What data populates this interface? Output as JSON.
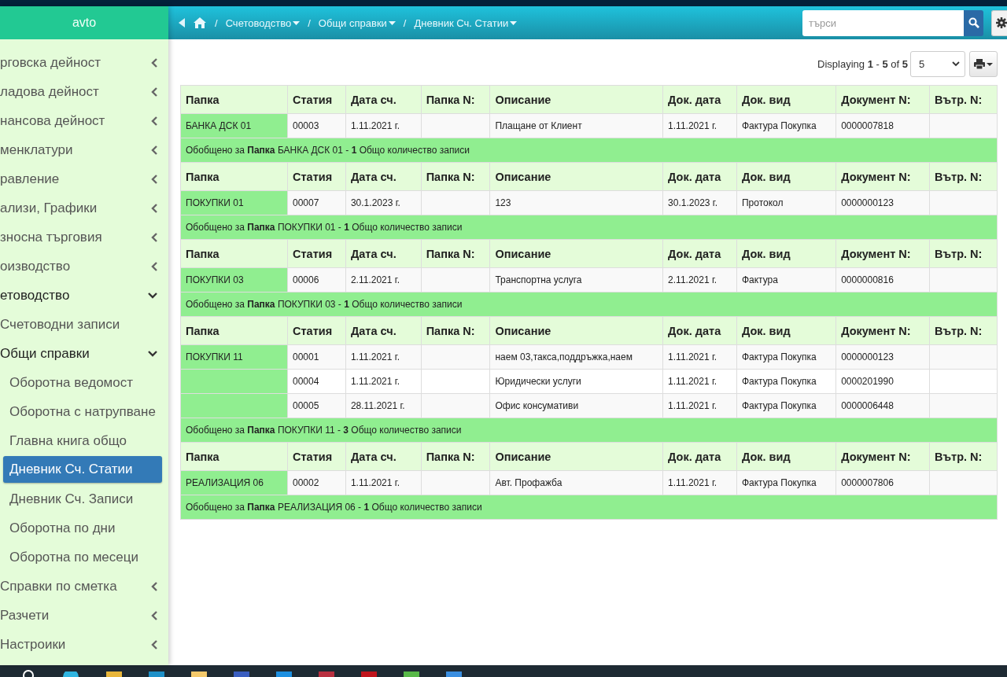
{
  "sidebar": {
    "title": "avto",
    "items": [
      {
        "label": "рговска дейност",
        "expanded": false,
        "selected": false
      },
      {
        "label": "ладова дейност",
        "expanded": false,
        "selected": false
      },
      {
        "label": "нансова дейност",
        "expanded": false,
        "selected": false
      },
      {
        "label": "менклатури",
        "expanded": false,
        "selected": false
      },
      {
        "label": "равление",
        "expanded": false,
        "selected": false
      },
      {
        "label": "ализи, Графики",
        "expanded": false,
        "selected": false
      },
      {
        "label": "зносна търговия",
        "expanded": false,
        "selected": false
      },
      {
        "label": "оизводство",
        "expanded": false,
        "selected": false
      },
      {
        "label": "етоводство",
        "expanded": true,
        "selected": false,
        "children": [
          {
            "label": "Счетоводни записи",
            "selected": false
          },
          {
            "label": "Общи справки",
            "expanded": true,
            "selected": false,
            "children": [
              {
                "label": "Оборотна ведомост",
                "selected": false
              },
              {
                "label": "Оборотна с натрупване",
                "selected": false
              },
              {
                "label": "Главна книга общо",
                "selected": false
              },
              {
                "label": "Дневник Сч. Статии",
                "selected": true
              },
              {
                "label": "Дневник Сч. Записи",
                "selected": false
              },
              {
                "label": "Оборотна по дни",
                "selected": false
              },
              {
                "label": "Оборотна по месеци",
                "selected": false
              }
            ]
          }
        ]
      },
      {
        "label": "Справки по сметка",
        "expanded": false,
        "selected": false
      },
      {
        "label": "Разчети",
        "expanded": false,
        "selected": false
      },
      {
        "label": "Настроики",
        "expanded": false,
        "selected": false
      }
    ]
  },
  "breadcrumb": [
    {
      "label": "Счетоводство",
      "separator": "/"
    },
    {
      "label": "Общи справки",
      "separator": "/"
    },
    {
      "label": "Дневник Сч. Статии",
      "separator": "/"
    }
  ],
  "search": {
    "placeholder": "търси"
  },
  "toolbar": {
    "displaying": "Displaying **1** - **5** of **5**",
    "page_size": "5"
  },
  "table": {
    "groups": [
      {
        "columns": [
          "Папка",
          "Статия",
          "Дата сч.",
          "Папка N:",
          "Описание",
          "Док. дата",
          "Док. вид",
          "Документ N:",
          "Вътр. N:"
        ],
        "rows": [
          {
            "folder": "БАНКА ДСК 01",
            "article": "00003",
            "date": "1.11.2021 г.",
            "description": "Плащане от Клиент",
            "doc_date": "1.11.2021 г.",
            "doc_type": "Фактура Покупка",
            "doc_number": "0000007818"
          }
        ],
        "summary": "Обобщено за **Папка** БАНКА ДСК 01  - **1** Общо количество записи"
      },
      {
        "columns": [
          "Папка",
          "Статия",
          "Дата сч.",
          "Папка N:",
          "Описание",
          "Док. дата",
          "Док. вид",
          "Документ N:",
          "Вътр. N:"
        ],
        "rows": [
          {
            "folder": "ПОКУПКИ 01",
            "article": "00007",
            "date": "30.1.2023 г.",
            "description": "123",
            "doc_date": "30.1.2023 г.",
            "doc_type": "Протокол",
            "doc_number": "0000000123"
          }
        ],
        "summary": "Обобщено за **Папка** ПОКУПКИ 01  - **1** Общо количество записи"
      },
      {
        "columns": [
          "Папка",
          "Статия",
          "Дата сч.",
          "Папка N:",
          "Описание",
          "Док. дата",
          "Док. вид",
          "Документ N:",
          "Вътр. N:"
        ],
        "rows": [
          {
            "folder": "ПОКУПКИ 03",
            "article": "00006",
            "date": "2.11.2021 г.",
            "description": "Транспортна услуга",
            "doc_date": "2.11.2021 г.",
            "doc_type": "Фактура",
            "doc_number": "0000000816"
          }
        ],
        "summary": "Обобщено за **Папка** ПОКУПКИ 03  - **1** Общо количество записи"
      },
      {
        "columns": [
          "Папка",
          "Статия",
          "Дата сч.",
          "Папка N:",
          "Описание",
          "Док. дата",
          "Док. вид",
          "Документ N:",
          "Вътр. N:"
        ],
        "rows": [
          {
            "folder": "ПОКУПКИ 11",
            "article": "00001",
            "date": "1.11.2021 г.",
            "description": "наем 03,такса,поддръжка,наем",
            "doc_date": "1.11.2021 г.",
            "doc_type": "Фактура Покупка",
            "doc_number": "0000000123"
          },
          {
            "article": "00004",
            "date": "1.11.2021 г.",
            "description": "Юридически услуги",
            "doc_date": "1.11.2021 г.",
            "doc_type": "Фактура Покупка",
            "doc_number": "0000201990"
          },
          {
            "article": "00005",
            "date": "28.11.2021 г.",
            "description": "Офис консумативи",
            "doc_date": "1.11.2021 г.",
            "doc_type": "Фактура Покупка",
            "doc_number": "0000006448"
          }
        ],
        "summary": "Обобщено за **Папка** ПОКУПКИ 11  - **3** Общо количество записи"
      },
      {
        "columns": [
          "Папка",
          "Статия",
          "Дата сч.",
          "Папка N:",
          "Описание",
          "Док. дата",
          "Док. вид",
          "Документ N:",
          "Вътр. N:"
        ],
        "rows": [
          {
            "folder": "РЕАЛИЗАЦИЯ 06",
            "article": "00002",
            "date": "1.11.2021 г.",
            "description": "Авт. Профажба",
            "doc_date": "1.11.2021 г.",
            "doc_type": "Фактура Покупка",
            "doc_number": "0000007806"
          }
        ],
        "summary": "Обобщено за **Папка** РЕАЛИЗАЦИЯ 06  - **1** Общо количество записи"
      }
    ]
  }
}
